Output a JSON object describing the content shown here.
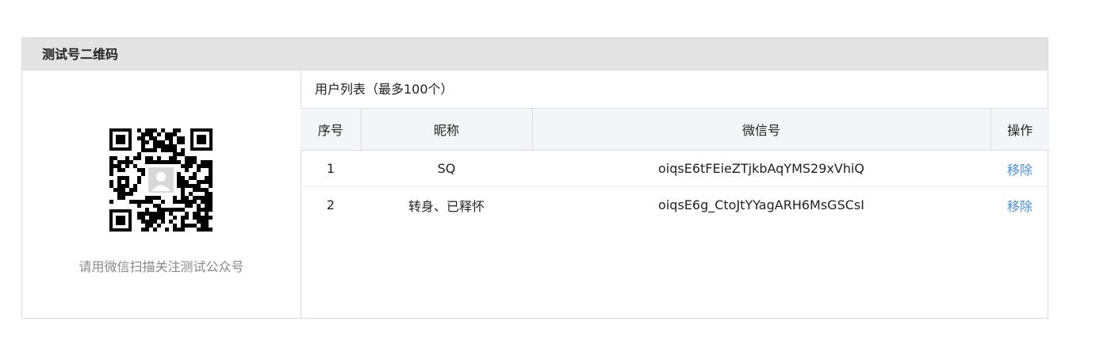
{
  "panel": {
    "title": "测试号二维码"
  },
  "qr": {
    "caption": "请用微信扫描关注测试公众号",
    "avatar_icon": "user-avatar-icon"
  },
  "user_list": {
    "title": "用户列表（最多100个）",
    "columns": [
      "序号",
      "昵称",
      "微信号",
      "操作"
    ],
    "rows": [
      {
        "index": "1",
        "nickname": "SQ",
        "wechat_id": "oiqsE6tFEieZTjkbAqYMS29xVhiQ",
        "action": "移除"
      },
      {
        "index": "2",
        "nickname": "转身、已释怀",
        "wechat_id": "oiqsE6g_CtoJtYYagARH6MsGSCsI",
        "action": "移除"
      }
    ]
  },
  "colors": {
    "link": "#4a90d9",
    "header_bg": "#e3e3e3",
    "table_header_bg": "#f4f5f9"
  }
}
